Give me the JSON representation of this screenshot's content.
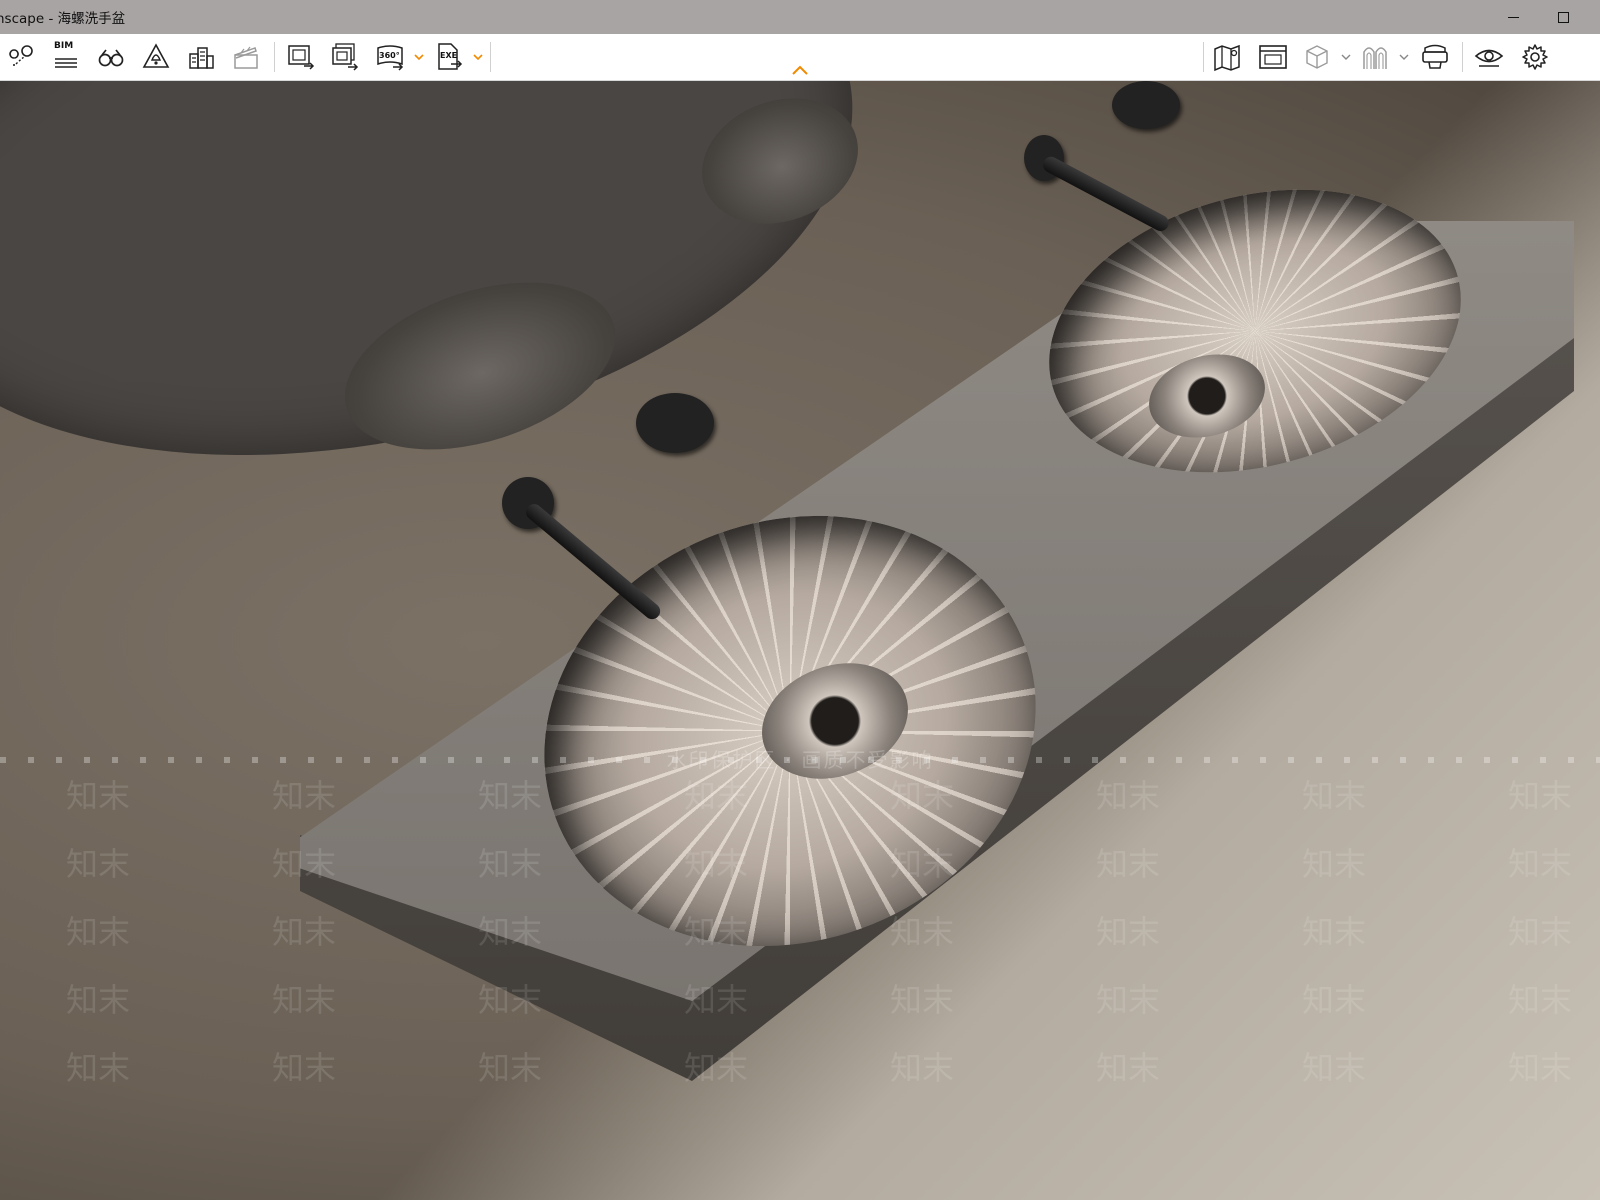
{
  "window": {
    "title": "nscape - 海螺洗手盆"
  },
  "toolbar": {
    "bim_label": "BIM",
    "tool_360_label": "360°",
    "exe_label": "EXE"
  },
  "viewport": {
    "watermark_text": "水印保护区 · 画质不受影响",
    "watermark_mark": "知末"
  },
  "colors": {
    "titlebar_bg": "#a9a4a4",
    "toolbar_bg": "#ffffff",
    "accent": "#f08a00"
  }
}
